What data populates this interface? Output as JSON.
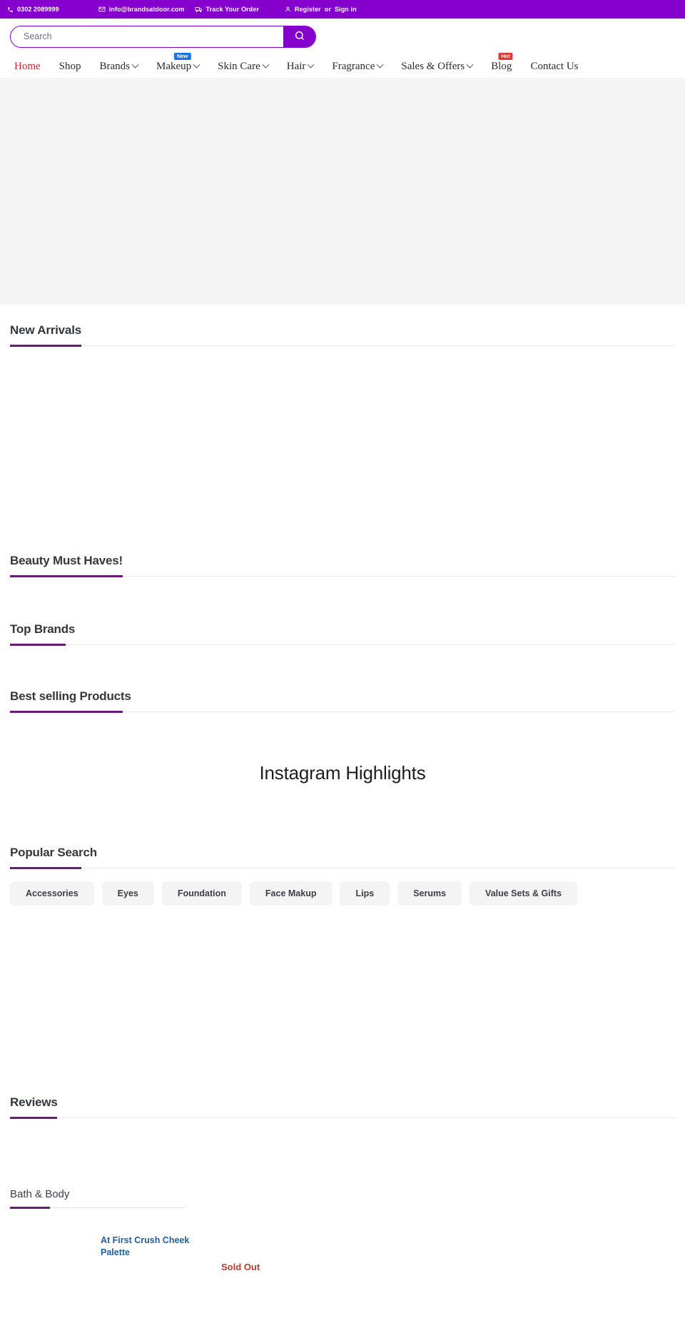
{
  "topbar": {
    "phone": "0302 2089999",
    "email": "info@brandsatdoor.com",
    "track_order": "Track Your Order",
    "register": "Register",
    "or": "or",
    "signin": "Sign in",
    "background": "#8500cc"
  },
  "search": {
    "placeholder": "Search",
    "value": "",
    "button_icon": "search-icon",
    "accent": "#8500cc"
  },
  "nav": {
    "items": [
      {
        "label": "Home",
        "active": true,
        "caret": false,
        "badge": null
      },
      {
        "label": "Shop",
        "active": false,
        "caret": false,
        "badge": null
      },
      {
        "label": "Brands",
        "active": false,
        "caret": true,
        "badge": null
      },
      {
        "label": "Makeup",
        "active": false,
        "caret": true,
        "badge": "New",
        "badge_type": "new"
      },
      {
        "label": "Skin Care",
        "active": false,
        "caret": true,
        "badge": null
      },
      {
        "label": "Hair",
        "active": false,
        "caret": true,
        "badge": null
      },
      {
        "label": "Fragrance",
        "active": false,
        "caret": true,
        "badge": null
      },
      {
        "label": "Sales & Offers",
        "active": false,
        "caret": true,
        "badge": null
      },
      {
        "label": "Blog",
        "active": false,
        "caret": false,
        "badge": "Hot",
        "badge_type": "hot"
      },
      {
        "label": "Contact Us",
        "active": false,
        "caret": false,
        "badge": null
      }
    ],
    "active_color": "#c32a2a",
    "badge_new_color": "#1a73e8",
    "badge_hot_color": "#e53935"
  },
  "sections": {
    "new_arrivals": "New Arrivals",
    "beauty_must_haves": "Beauty Must Haves!",
    "top_brands": "Top Brands",
    "best_selling": "Best selling Products",
    "instagram": "Instagram Highlights",
    "popular_search": "Popular Search",
    "reviews": "Reviews",
    "underline_color": "#6a1b7a"
  },
  "popular_search": {
    "tags": [
      "Accessories",
      "Eyes",
      "Foundation",
      "Face Makup",
      "Lips",
      "Serums",
      "Value Sets & Gifts"
    ]
  },
  "bath_body": {
    "title": "Bath & Body",
    "product": {
      "name": "At First Crush Cheek Palette",
      "status": "Sold Out",
      "name_color": "#1f5fa0",
      "status_color": "#c0392b"
    }
  }
}
